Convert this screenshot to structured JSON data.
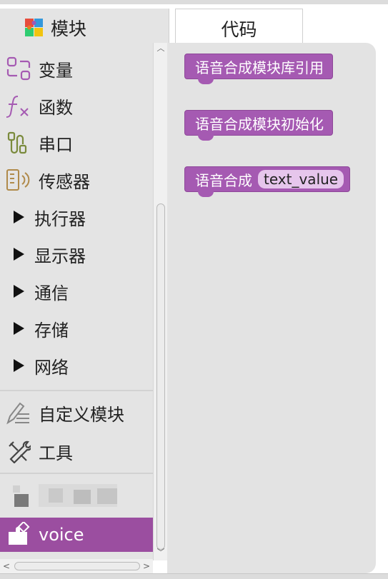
{
  "tabs": {
    "modules_label": "模块",
    "code_label": "代码"
  },
  "sidebar": {
    "categories": [
      {
        "label": "变量",
        "icon": "variable-icon"
      },
      {
        "label": "函数",
        "icon": "function-icon"
      },
      {
        "label": "串口",
        "icon": "serial-port-icon"
      },
      {
        "label": "传感器",
        "icon": "sensor-icon"
      },
      {
        "label": "执行器",
        "icon": "expand-triangle-icon"
      },
      {
        "label": "显示器",
        "icon": "expand-triangle-icon"
      },
      {
        "label": "通信",
        "icon": "expand-triangle-icon"
      },
      {
        "label": "存储",
        "icon": "expand-triangle-icon"
      },
      {
        "label": "网络",
        "icon": "expand-triangle-icon"
      },
      {
        "label": "自定义模块",
        "icon": "pencil-lines-icon"
      },
      {
        "label": "工具",
        "icon": "tools-icon"
      },
      {
        "label": "voice",
        "icon": "puzzle-icon"
      }
    ]
  },
  "blocks": {
    "lib_ref": "语音合成模块库引用",
    "init": "语音合成模块初始化",
    "synth_label": "语音合成",
    "synth_field": "text_value"
  },
  "colors": {
    "sidebar_bg": "#e4e4e4",
    "block_purple": "#a55ab2",
    "active_category": "#9b4ea0",
    "workspace_bg": "#e3e3e3"
  }
}
